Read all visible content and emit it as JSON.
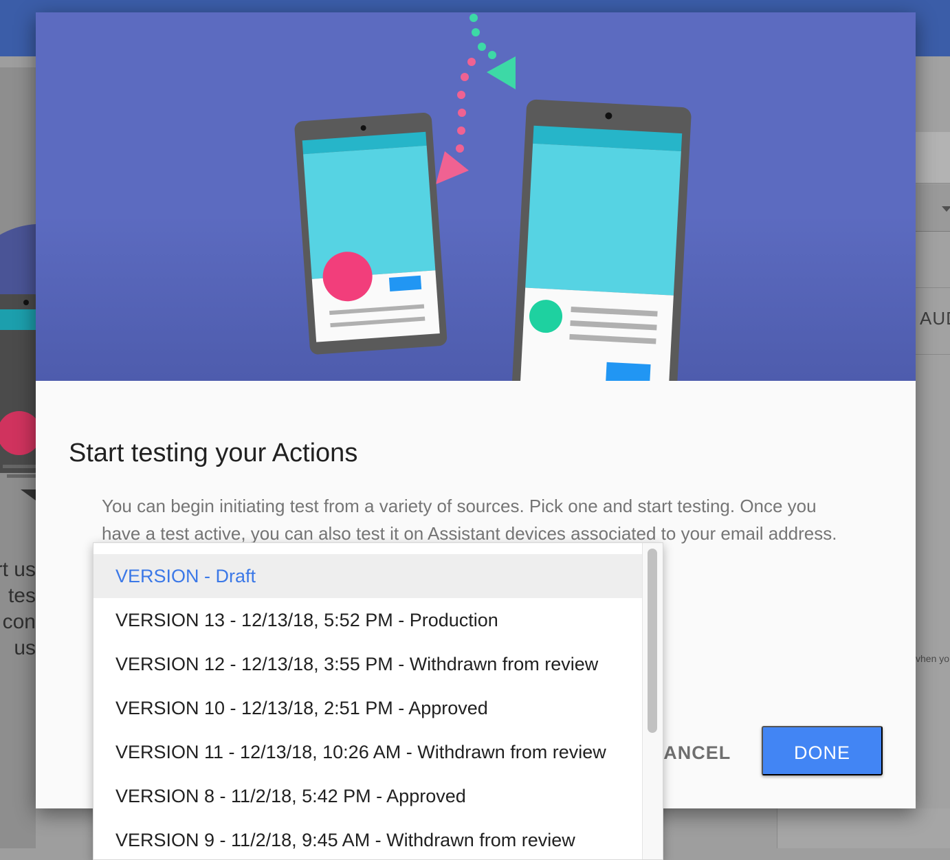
{
  "background": {
    "left_text_lines": [
      "rt us",
      "tes",
      "con",
      "us"
    ],
    "right_tab_label": "AUD",
    "right_small_text": "vhen yo"
  },
  "dialog": {
    "title": "Start testing your Actions",
    "body": "You can begin initiating test from a variety of sources. Pick one and start testing. Once you have a test active, you can also test it on Assistant devices associated to your email address.",
    "cancel_label": "CANCEL",
    "done_label": "DONE",
    "colors": {
      "hero_bg": "#5c6bc0",
      "accent": "#4285f4"
    }
  },
  "version_dropdown": {
    "selected": "VERSION - Draft",
    "options": [
      "VERSION - Draft",
      "VERSION 13 - 12/13/18, 5:52 PM - Production",
      "VERSION 12 - 12/13/18, 3:55 PM - Withdrawn from review",
      "VERSION 10 - 12/13/18, 2:51 PM - Approved",
      "VERSION 11 - 12/13/18, 10:26 AM - Withdrawn from review",
      "VERSION 8 - 11/2/18, 5:42 PM - Approved",
      "VERSION 9 - 11/2/18, 9:45 AM - Withdrawn from review"
    ]
  }
}
